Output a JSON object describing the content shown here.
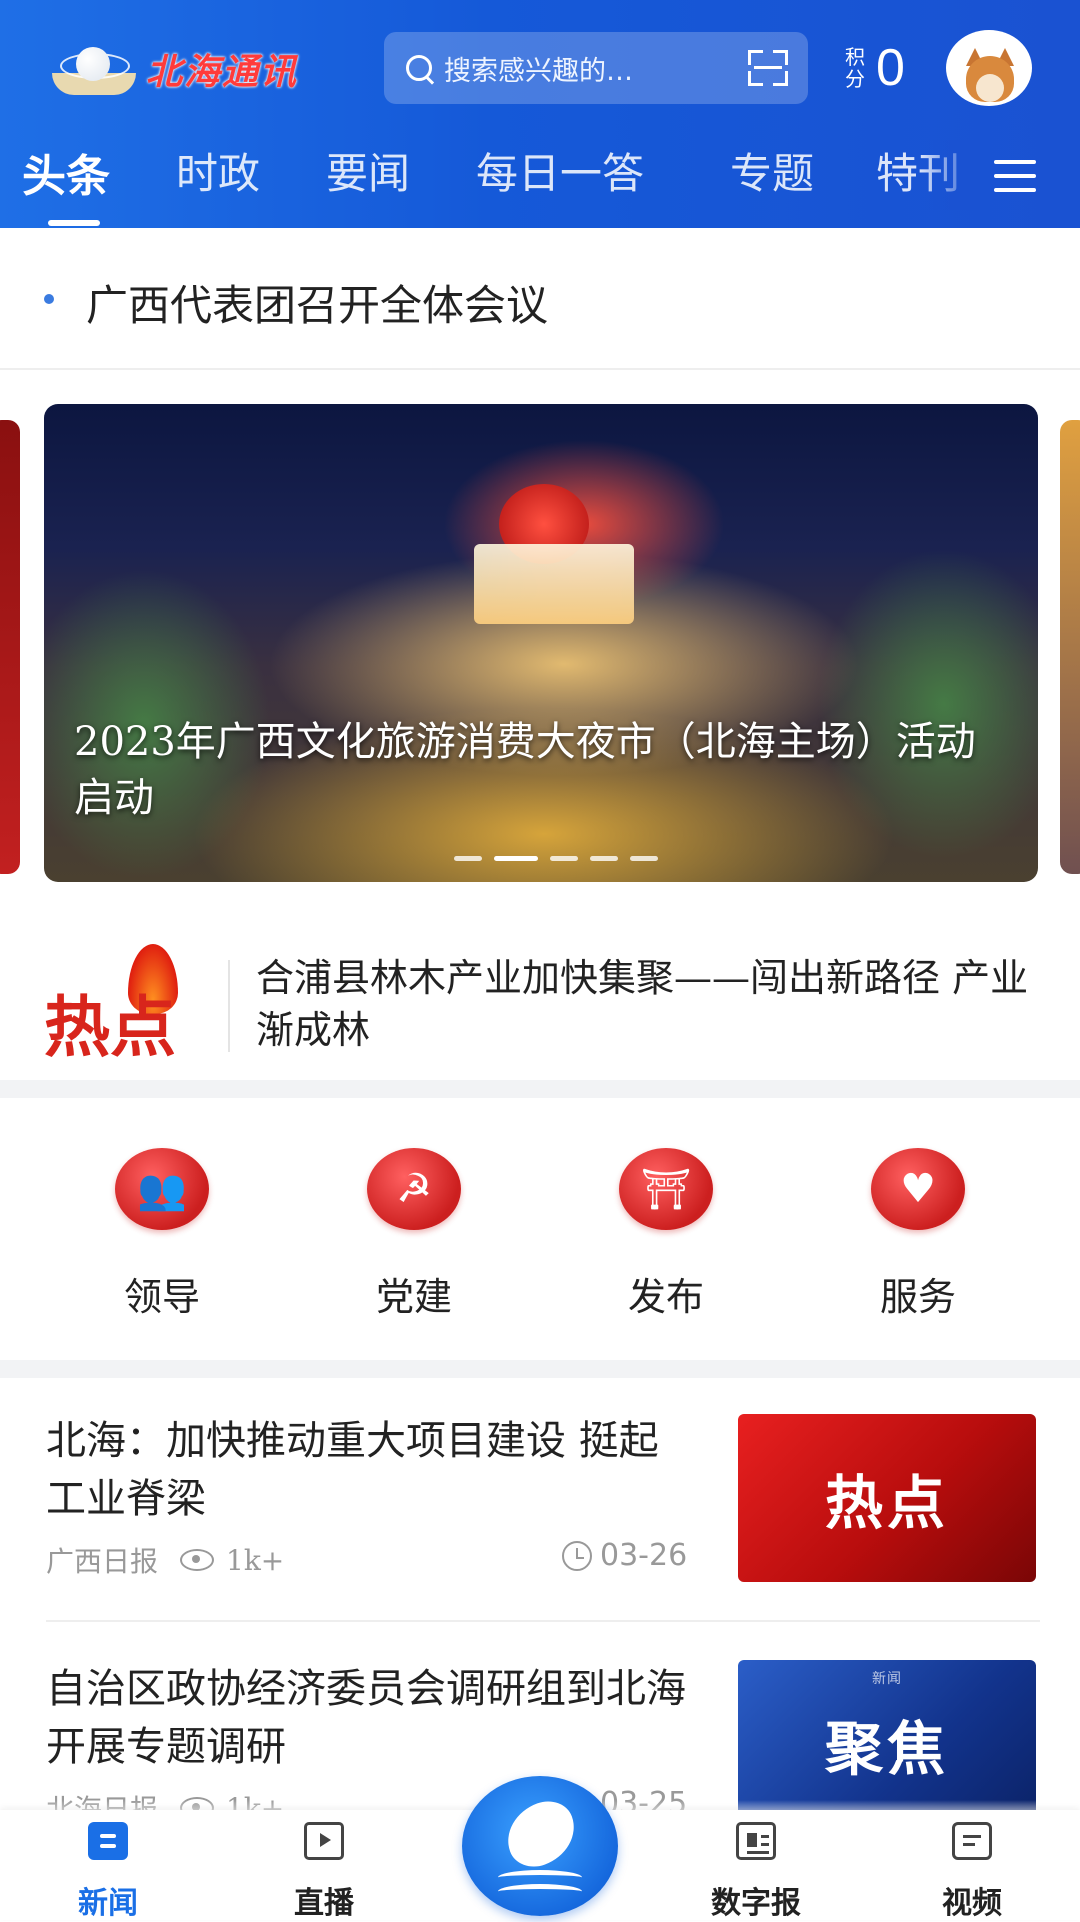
{
  "header": {
    "app_name": "北海通讯",
    "search_placeholder": "搜索感兴趣的…",
    "points_label": "积分",
    "points_value": "0"
  },
  "tabs": [
    {
      "label": "头条",
      "active": true
    },
    {
      "label": "时政"
    },
    {
      "label": "要闻"
    },
    {
      "label": "每日一答"
    },
    {
      "label": "专题"
    },
    {
      "label": "特刊"
    }
  ],
  "headline": {
    "text": "广西代表团召开全体会议"
  },
  "carousel": {
    "caption": "2023年广西文化旅游消费大夜市（北海主场）活动启动",
    "dot_count": 5,
    "active_dot": 1
  },
  "hot": {
    "badge": "热点",
    "text": "合浦县林木产业加快集聚——闯出新路径 产业渐成林"
  },
  "quick_links": [
    {
      "label": "领导",
      "icon": "leaders-icon"
    },
    {
      "label": "党建",
      "icon": "party-emblem-icon"
    },
    {
      "label": "发布",
      "icon": "press-release-icon"
    },
    {
      "label": "服务",
      "icon": "service-heart-icon"
    }
  ],
  "news": [
    {
      "title": "北海：加快推动重大项目建设 挺起工业脊梁",
      "source": "广西日报",
      "views": "1k+",
      "date": "03-26",
      "thumb_text": "热点"
    },
    {
      "title": "自治区政协经济委员会调研组到北海开展专题调研",
      "source": "北海日报",
      "views": "1k+",
      "date": "03-25",
      "thumb_text": "聚焦",
      "thumb_sub": "新闻"
    }
  ],
  "bottom_nav": [
    {
      "label": "新闻",
      "icon": "news-icon",
      "active": true
    },
    {
      "label": "直播",
      "icon": "live-tv-icon"
    },
    {
      "label": "",
      "icon": "dolphin-logo-icon"
    },
    {
      "label": "数字报",
      "icon": "digital-paper-icon"
    },
    {
      "label": "视频",
      "icon": "video-icon"
    }
  ],
  "colors": {
    "header_blue": "#1a52d2",
    "accent_blue": "#1a6fe6",
    "accent_red": "#d8251c"
  }
}
